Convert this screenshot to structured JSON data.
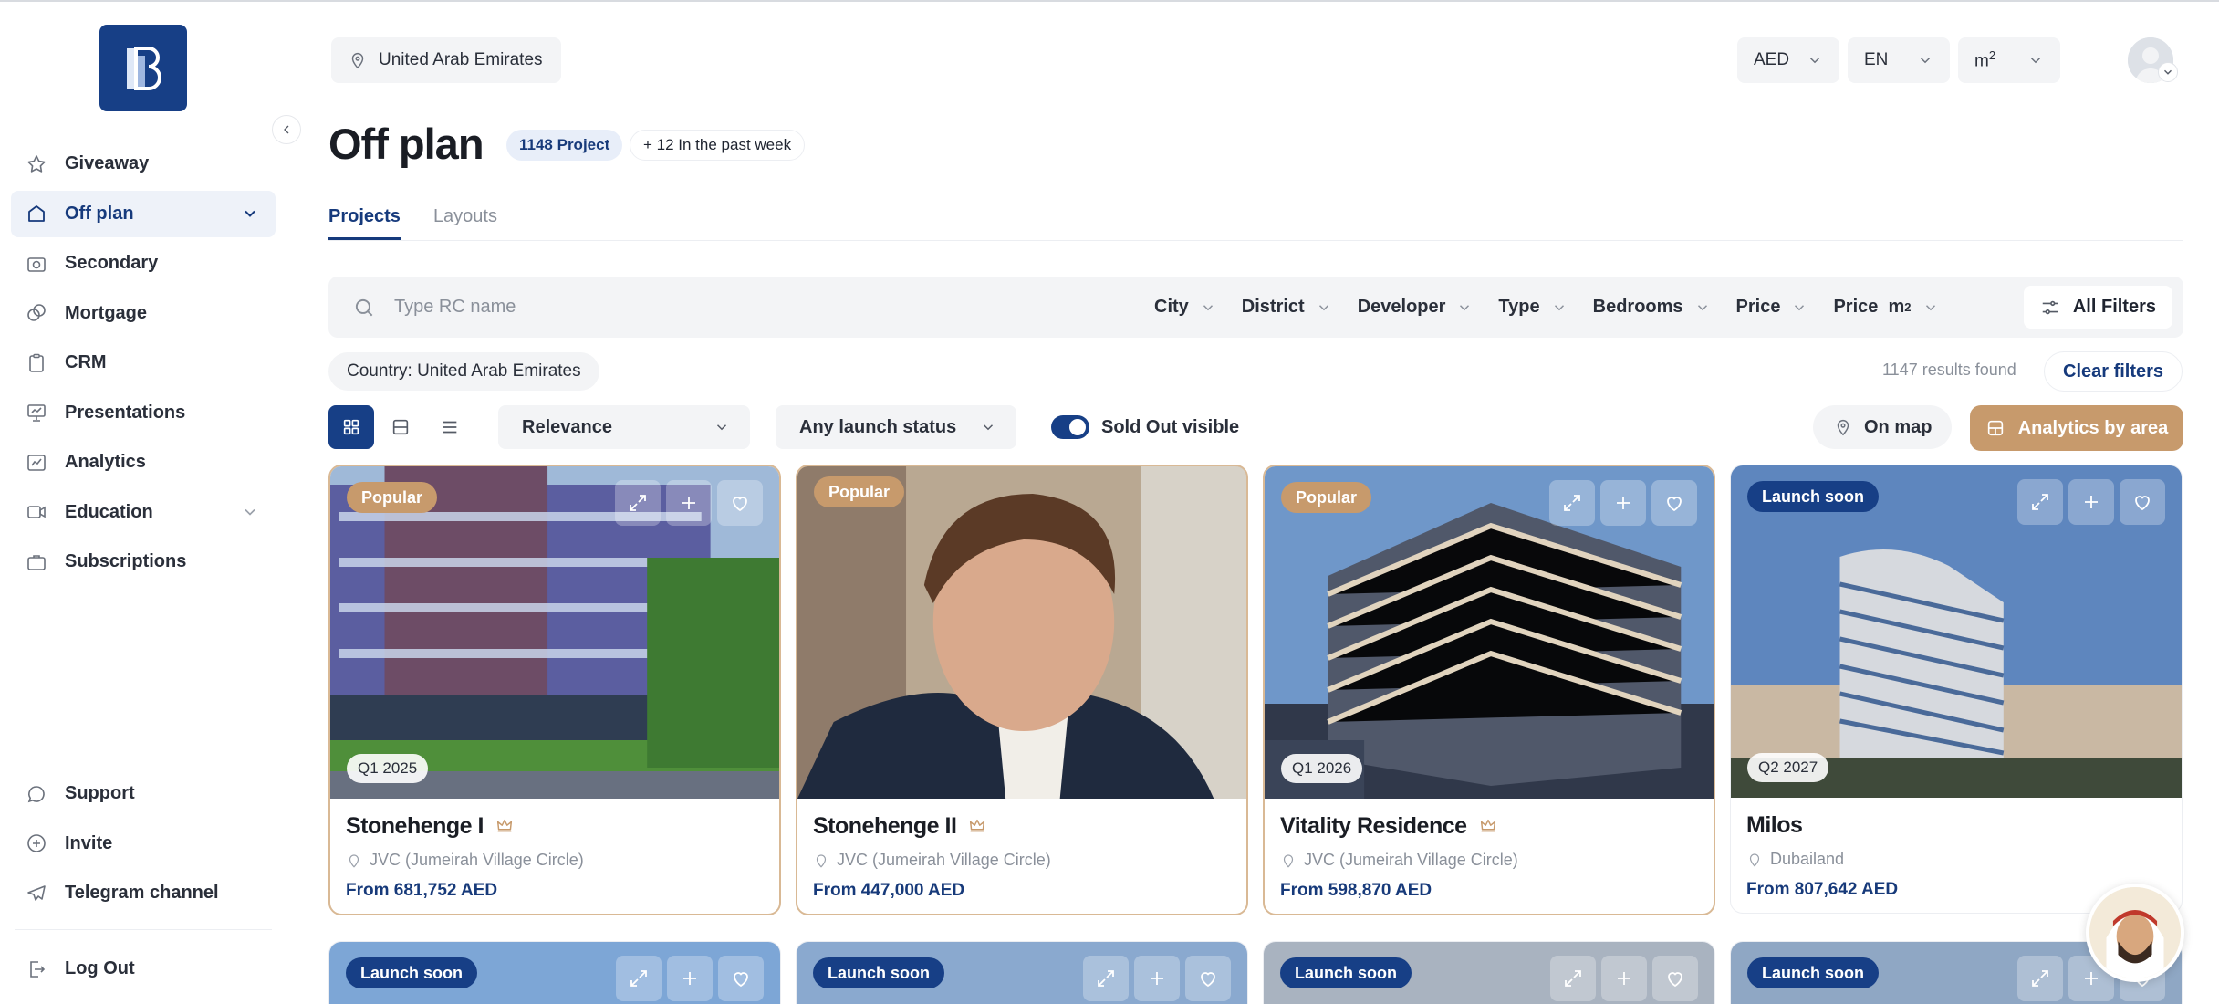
{
  "sidebar": {
    "items": [
      {
        "label": "Giveaway",
        "icon": "star-icon"
      },
      {
        "label": "Off plan",
        "icon": "home-icon",
        "active": true
      },
      {
        "label": "Secondary",
        "icon": "camera-icon"
      },
      {
        "label": "Mortgage",
        "icon": "coins-icon"
      },
      {
        "label": "CRM",
        "icon": "clipboard-icon"
      },
      {
        "label": "Presentations",
        "icon": "presentation-icon"
      },
      {
        "label": "Analytics",
        "icon": "chart-icon"
      },
      {
        "label": "Education",
        "icon": "video-icon"
      },
      {
        "label": "Subscriptions",
        "icon": "briefcase-icon"
      }
    ],
    "bottom_items": [
      {
        "label": "Support",
        "icon": "chat-icon"
      },
      {
        "label": "Invite",
        "icon": "plus-circle-icon"
      },
      {
        "label": "Telegram channel",
        "icon": "send-icon"
      }
    ],
    "logout_label": "Log Out"
  },
  "header": {
    "country": "United Arab Emirates",
    "currency": "AED",
    "language": "EN",
    "unit": "m",
    "unit_sup": "2"
  },
  "page": {
    "title": "Off plan",
    "project_count": "1148 Project",
    "week_badge": "+ 12 In the past week",
    "tabs": [
      "Projects",
      "Layouts"
    ]
  },
  "filters": {
    "search_placeholder": "Type RC name",
    "items": [
      "City",
      "District",
      "Developer",
      "Type",
      "Bedrooms",
      "Price",
      "Price  m"
    ],
    "price_m_sup": "2",
    "all_filters": "All Filters",
    "country_tag": "Country: United Arab Emirates",
    "results": "1147 results found",
    "clear": "Clear filters",
    "sort": "Relevance",
    "launch_status": "Any launch status",
    "sold_out": "Sold Out visible",
    "on_map": "On map",
    "analytics": "Analytics by area"
  },
  "cards": [
    {
      "tag": "Popular",
      "quarter": "Q1 2025",
      "title": "Stonehenge I",
      "location": "JVC (Jumeirah Village Circle)",
      "price": "From 681,752 AED"
    },
    {
      "tag": "Popular",
      "quarter": "",
      "title": "Stonehenge II",
      "location": "JVC (Jumeirah Village Circle)",
      "price": "From 447,000 AED"
    },
    {
      "tag": "Popular",
      "quarter": "Q1 2026",
      "title": "Vitality Residence",
      "location": "JVC (Jumeirah Village Circle)",
      "price": "From 598,870 AED"
    },
    {
      "tag": "Launch soon",
      "quarter": "Q2 2027",
      "title": "Milos",
      "location": "Dubailand",
      "price": "From 807,642 AED"
    }
  ],
  "cards_row2": [
    {
      "tag": "Launch soon"
    },
    {
      "tag": "Launch soon"
    },
    {
      "tag": "Launch soon"
    },
    {
      "tag": "Launch soon"
    }
  ],
  "colors": {
    "primary": "#173f86",
    "accent": "#c79a6c"
  }
}
